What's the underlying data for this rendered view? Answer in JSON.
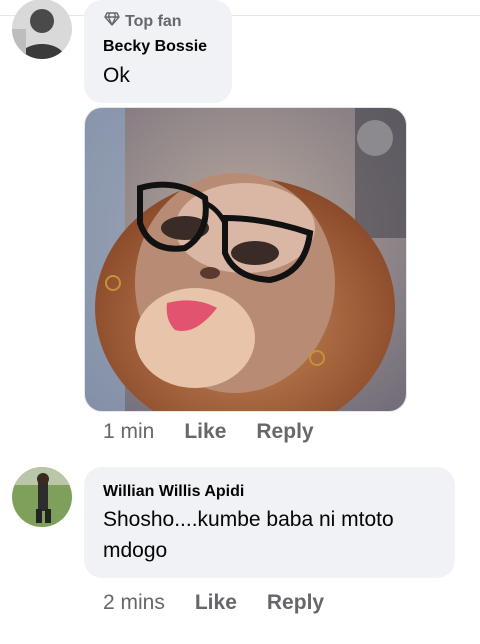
{
  "comments": [
    {
      "badge": "Top fan",
      "badge_icon": "diamond-icon",
      "author": "Becky Bossie",
      "text": "Ok",
      "time": "1 min",
      "like_label": "Like",
      "reply_label": "Reply"
    },
    {
      "author": "Willian Willis Apidi",
      "text_line1": "Shosho....kumbe baba ni mtoto",
      "text_line2": "mdogo",
      "time": "2 mins",
      "like_label": "Like",
      "reply_label": "Reply"
    }
  ],
  "colors": {
    "bubble": "#f0f2f5",
    "secondary_text": "#65676b",
    "primary_text": "#050505"
  }
}
